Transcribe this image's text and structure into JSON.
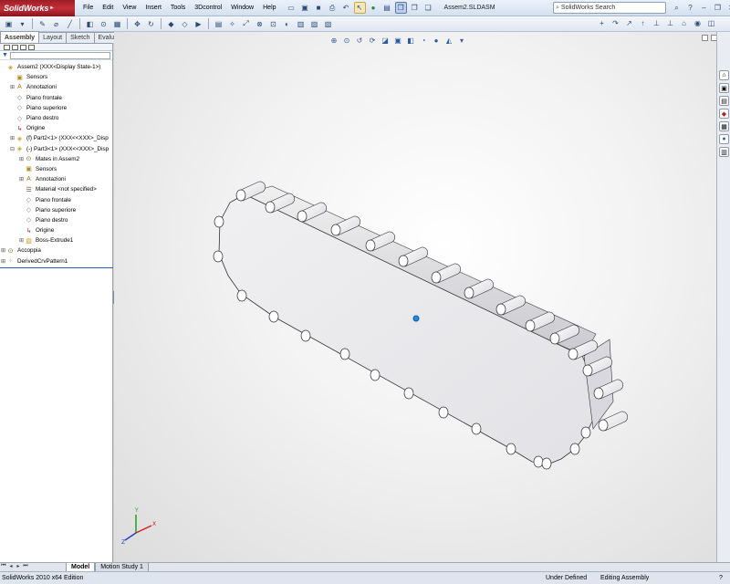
{
  "app": {
    "logo_text": "SolidWorks",
    "logo_arrow": "▸",
    "menu": [
      "File",
      "Edit",
      "View",
      "Insert",
      "Tools",
      "3Dcontrol",
      "Window",
      "Help"
    ],
    "document_name": "Assem2.SLDASM",
    "search_placeholder": "SolidWorks Search",
    "search_icon": "search-icon"
  },
  "command_manager": {
    "tabs": [
      "Assembly",
      "Layout",
      "Sketch",
      "Evaluate"
    ],
    "active_tab": "Assembly"
  },
  "feature_tree": {
    "items": [
      {
        "label": "Assem2  (XXX<Display State-1>)",
        "indent": 0,
        "exp": "",
        "icon": "assembly-icon"
      },
      {
        "label": "Sensors",
        "indent": 1,
        "exp": "",
        "icon": "sensor-icon"
      },
      {
        "label": "Annotazioni",
        "indent": 1,
        "exp": "+",
        "icon": "annotation-icon"
      },
      {
        "label": "Piano frontale",
        "indent": 1,
        "exp": "",
        "icon": "plane-icon"
      },
      {
        "label": "Piano superiore",
        "indent": 1,
        "exp": "",
        "icon": "plane-icon"
      },
      {
        "label": "Piano destro",
        "indent": 1,
        "exp": "",
        "icon": "plane-icon"
      },
      {
        "label": "Origine",
        "indent": 1,
        "exp": "",
        "icon": "origin-icon"
      },
      {
        "label": "(f) Part2<1> (XXX<<XXX>_Disp",
        "indent": 1,
        "exp": "+",
        "icon": "part-icon"
      },
      {
        "label": "(-) Part3<1> (XXX<<XXX>_Disp",
        "indent": 1,
        "exp": "−",
        "icon": "part-icon"
      },
      {
        "label": "Mates in Assem2",
        "indent": 2,
        "exp": "+",
        "icon": "mates-icon"
      },
      {
        "label": "Sensors",
        "indent": 2,
        "exp": "",
        "icon": "sensor-icon"
      },
      {
        "label": "Annotazioni",
        "indent": 2,
        "exp": "+",
        "icon": "annotation-icon"
      },
      {
        "label": "Material <not specified>",
        "indent": 2,
        "exp": "",
        "icon": "material-icon"
      },
      {
        "label": "Piano frontale",
        "indent": 2,
        "exp": "",
        "icon": "plane-icon"
      },
      {
        "label": "Piano superiore",
        "indent": 2,
        "exp": "",
        "icon": "plane-icon"
      },
      {
        "label": "Piano destro",
        "indent": 2,
        "exp": "",
        "icon": "plane-icon"
      },
      {
        "label": "Origine",
        "indent": 2,
        "exp": "",
        "icon": "origin-icon"
      },
      {
        "label": "Boss-Extrude1",
        "indent": 2,
        "exp": "+",
        "icon": "extrude-icon"
      },
      {
        "label": "Accoppia",
        "indent": 0,
        "exp": "+",
        "icon": "mates-icon"
      },
      {
        "label": "DerivedCrvPattern1",
        "indent": 0,
        "exp": "+",
        "icon": "pattern-icon"
      }
    ]
  },
  "bottom_tabs": [
    "Model",
    "Motion Study 1"
  ],
  "active_bottom_tab": "Model",
  "status": {
    "edition": "SolidWorks 2010 x64 Edition",
    "units": "Under Defined",
    "mode": "Editing Assembly",
    "help": "?"
  },
  "colors": {
    "logo": "#b0262f",
    "selection_blue": "#2a5db8",
    "triad_x": "#d02020",
    "triad_y": "#20a020",
    "triad_z": "#2040d0"
  }
}
